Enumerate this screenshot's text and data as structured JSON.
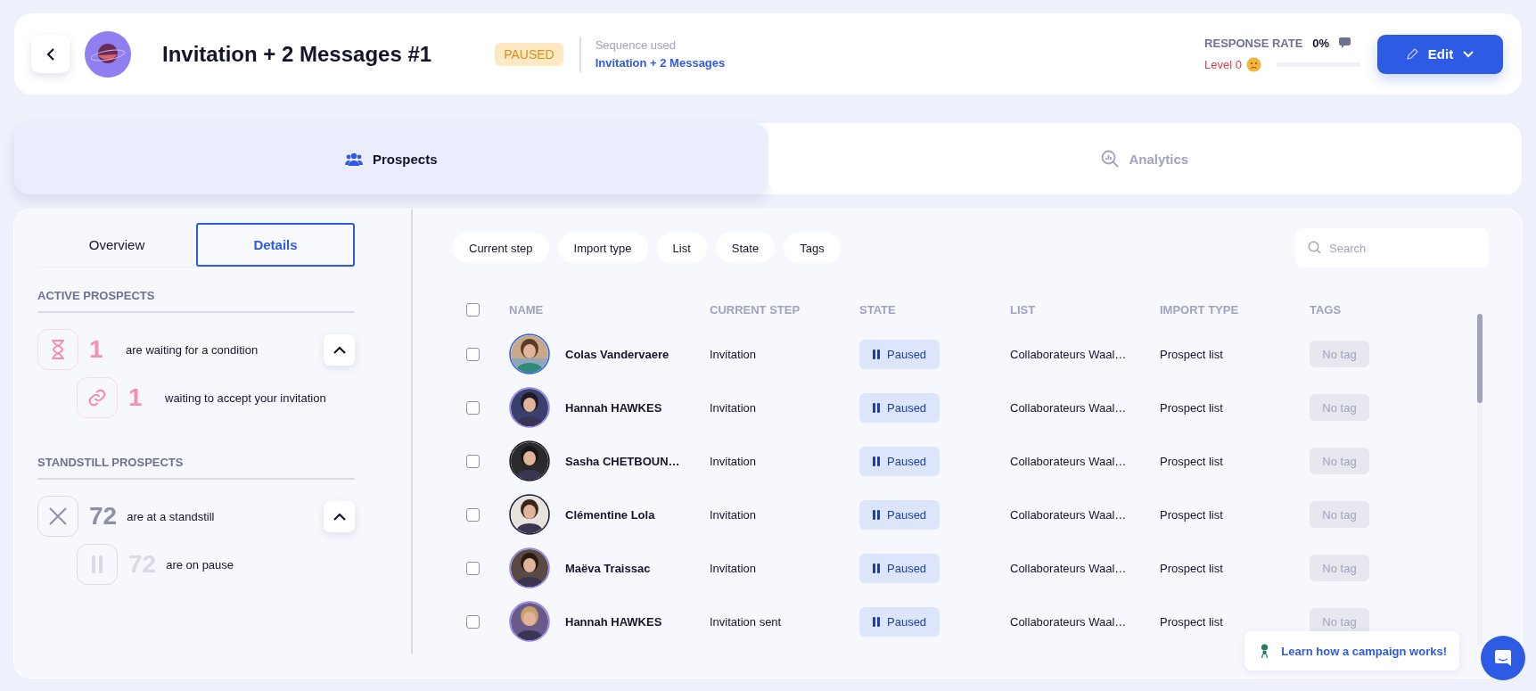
{
  "header": {
    "title": "Invitation + 2 Messages #1",
    "status": "PAUSED",
    "sequence_label": "Sequence used",
    "sequence_link": "Invitation + 2 Messages",
    "response_rate_label": "RESPONSE RATE",
    "response_rate": "0%",
    "level_label": "Level 0",
    "level": 0,
    "edit_button": "Edit"
  },
  "main_tabs": [
    {
      "label": "Prospects",
      "selected": true
    },
    {
      "label": "Analytics",
      "selected": false
    }
  ],
  "side_tabs": [
    {
      "label": "Overview",
      "selected": false
    },
    {
      "label": "Details",
      "selected": true
    }
  ],
  "sections": [
    {
      "title": "ACTIVE PROSPECTS",
      "expanded": true,
      "count": "1",
      "text": "are waiting for a condition",
      "children": [
        {
          "count": "1",
          "text": "waiting to accept your invitation"
        }
      ]
    },
    {
      "title": "STANDSTILL PROSPECTS",
      "expanded": true,
      "count": "72",
      "text": "are at a standstill",
      "children": [
        {
          "count": "72",
          "text": "are on pause"
        }
      ]
    }
  ],
  "filters": [
    "Current step",
    "Import type",
    "List",
    "State",
    "Tags"
  ],
  "search": {
    "placeholder": "Search"
  },
  "table": {
    "header_checked": false,
    "columns": [
      "NAME",
      "CURRENT STEP",
      "STATE",
      "LIST",
      "IMPORT TYPE",
      "TAGS"
    ],
    "rows": [
      {
        "checked": false,
        "name": "Colas Vandervaere",
        "step": "Invitation",
        "state": "Paused",
        "list": "Collaborateurs Waal…",
        "import_type": "Prospect list",
        "tag": "No tag"
      },
      {
        "checked": false,
        "name": "Hannah HAWKES",
        "step": "Invitation",
        "state": "Paused",
        "list": "Collaborateurs Waal…",
        "import_type": "Prospect list",
        "tag": "No tag"
      },
      {
        "checked": false,
        "name": "Sasha CHETBOUN…",
        "step": "Invitation",
        "state": "Paused",
        "list": "Collaborateurs Waal…",
        "import_type": "Prospect list",
        "tag": "No tag"
      },
      {
        "checked": false,
        "name": "Clémentine Lola",
        "step": "Invitation",
        "state": "Paused",
        "list": "Collaborateurs Waal…",
        "import_type": "Prospect list",
        "tag": "No tag"
      },
      {
        "checked": false,
        "name": "Maëva Traissac",
        "step": "Invitation",
        "state": "Paused",
        "list": "Collaborateurs Waal…",
        "import_type": "Prospect list",
        "tag": "No tag"
      },
      {
        "checked": false,
        "name": "Hannah HAWKES",
        "step": "Invitation sent",
        "state": "Paused",
        "list": "Collaborateurs Waal…",
        "import_type": "Prospect list",
        "tag": "No tag"
      }
    ]
  },
  "help_link": "Learn how a campaign works!"
}
